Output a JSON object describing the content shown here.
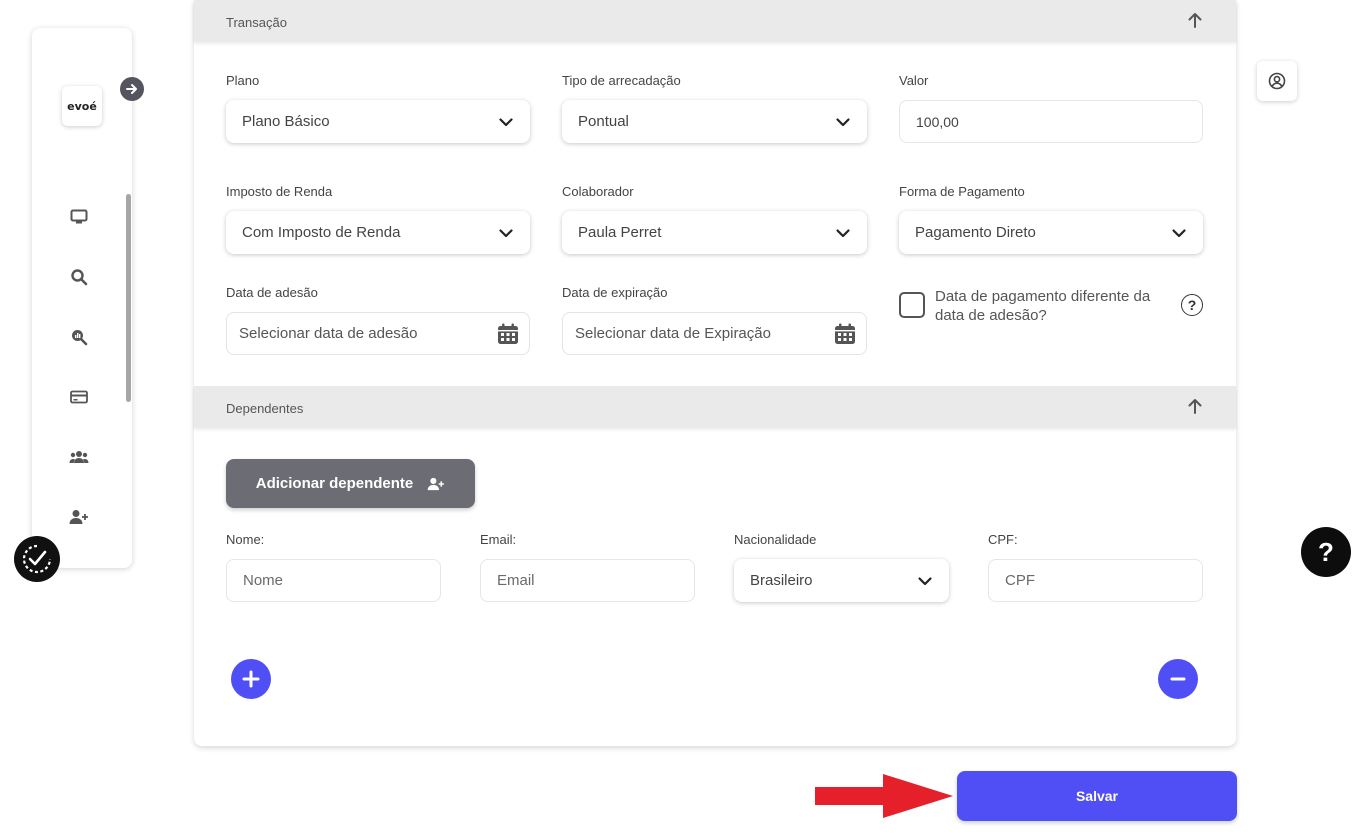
{
  "sidebar": {
    "logo_text": "evoé",
    "items": [
      {
        "icon": "monitor-icon"
      },
      {
        "icon": "search-icon"
      },
      {
        "icon": "analytics-search-icon"
      },
      {
        "icon": "credit-card-icon"
      },
      {
        "icon": "users-icon"
      },
      {
        "icon": "add-user-icon"
      }
    ]
  },
  "transacao": {
    "title": "Transação",
    "plano_label": "Plano",
    "plano_value": "Plano Básico",
    "tipo_label": "Tipo de arrecadação",
    "tipo_value": "Pontual",
    "valor_label": "Valor",
    "valor_value": "100,00",
    "imposto_label": "Imposto de Renda",
    "imposto_value": "Com Imposto de Renda",
    "colaborador_label": "Colaborador",
    "colaborador_value": "Paula Perret",
    "forma_label": "Forma de Pagamento",
    "forma_value": "Pagamento Direto",
    "adesao_label": "Data de adesão",
    "adesao_placeholder": "Selecionar data de adesão",
    "expiracao_label": "Data de expiração",
    "expiracao_placeholder": "Selecionar data de Expiração",
    "checkbox_label": "Data de pagamento diferente da data de adesão?",
    "help_glyph": "?"
  },
  "dependentes": {
    "title": "Dependentes",
    "add_button": "Adicionar dependente",
    "nome_label": "Nome:",
    "nome_placeholder": "Nome",
    "email_label": "Email:",
    "email_placeholder": "Email",
    "nacionalidade_label": "Nacionalidade",
    "nacionalidade_value": "Brasileiro",
    "cpf_label": "CPF:",
    "cpf_placeholder": "CPF"
  },
  "help_button": "?",
  "save_button": "Salvar",
  "colors": {
    "primary": "#4f4ff5",
    "secondary_button": "#6c6c74",
    "section_header": "#eaeaea",
    "annotation_arrow": "#e5202a"
  }
}
